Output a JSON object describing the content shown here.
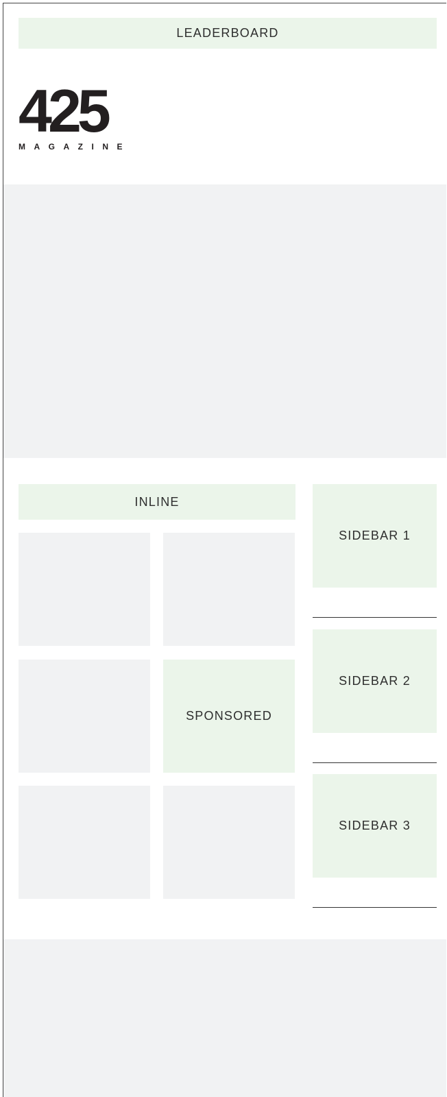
{
  "ads": {
    "leaderboard": "LEADERBOARD",
    "inline": "INLINE",
    "sponsored": "SPONSORED",
    "sidebar_1": "SIDEBAR 1",
    "sidebar_2": "SIDEBAR 2",
    "sidebar_3": "SIDEBAR 3"
  },
  "logo": {
    "number": "425",
    "wordmark": "MAGAZINE"
  },
  "colors": {
    "ad_background": "#ebf5ea",
    "placeholder_background": "#f1f2f3",
    "logo": "#231f20",
    "divider": "#333333"
  }
}
